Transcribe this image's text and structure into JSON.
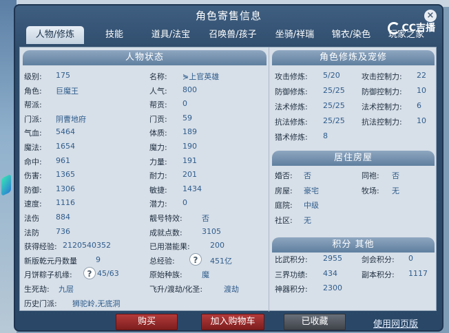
{
  "window": {
    "title": "角色寄售信息",
    "close_label": "×",
    "logo_text": "CC吉播"
  },
  "tabs": [
    "人物/修炼",
    "技能",
    "道具/法宝",
    "召唤兽/孩子",
    "坐骑/祥瑞",
    "锦衣/染色",
    "玩家之家"
  ],
  "left": {
    "header": "人物状态",
    "rows": [
      {
        "l1": "级别:",
        "v1": "175",
        "l2": "名称:",
        "v2": "⋟上官英雄"
      },
      {
        "l1": "角色:",
        "v1": "巨魔王",
        "l2": "人气:",
        "v2": "800"
      },
      {
        "l1": "帮派:",
        "v1": "",
        "l2": "帮贡:",
        "v2": "0"
      },
      {
        "l1": "门派:",
        "v1": "阴曹地府",
        "l2": "门贡:",
        "v2": "59"
      },
      {
        "l1": "气血:",
        "v1": "5464",
        "l2": "体质:",
        "v2": "189"
      },
      {
        "l1": "魔法:",
        "v1": "1654",
        "l2": "魔力:",
        "v2": "190"
      },
      {
        "l1": "命中:",
        "v1": "961",
        "l2": "力量:",
        "v2": "191"
      },
      {
        "l1": "伤害:",
        "v1": "1365",
        "l2": "耐力:",
        "v2": "201"
      },
      {
        "l1": "防御:",
        "v1": "1306",
        "l2": "敏捷:",
        "v2": "1434"
      },
      {
        "l1": "速度:",
        "v1": "1116",
        "l2": "潜力:",
        "v2": "0"
      },
      {
        "l1": "法伤",
        "v1": "884",
        "l2": "靓号特效:",
        "v2": "否"
      },
      {
        "l1": "法防",
        "v1": "736",
        "l2": "成就点数:",
        "v2": "3105"
      },
      {
        "l1": "获得经验:",
        "v1": "2120540352",
        "l2": "已用潜能果:",
        "v2": "200"
      },
      {
        "l1": "新版乾元丹数量",
        "v1": "9",
        "l2": "总经验:",
        "v2": "451亿"
      },
      {
        "l1": "月饼粽子机缘:",
        "v1": "45/63",
        "l2": "原始种族:",
        "v2": "魔"
      },
      {
        "l1": "生死劫:",
        "v1": "九层",
        "l2": "飞升/渡劫/化圣:",
        "v2": "渡劫"
      },
      {
        "l1": "历史门派:",
        "v1": "狮驼岭,无底洞",
        "l2": "",
        "v2": ""
      }
    ]
  },
  "cultivation": {
    "header": "角色修炼及宠修",
    "rows": [
      {
        "l1": "攻击修炼:",
        "v1": "5/20",
        "l2": "攻击控制力:",
        "v2": "22"
      },
      {
        "l1": "防御修炼:",
        "v1": "25/25",
        "l2": "防御控制力:",
        "v2": "10"
      },
      {
        "l1": "法术修炼:",
        "v1": "25/25",
        "l2": "法术控制力:",
        "v2": "6"
      },
      {
        "l1": "抗法修炼:",
        "v1": "25/25",
        "l2": "抗法控制力:",
        "v2": "10"
      },
      {
        "l1": "猎术修炼:",
        "v1": "8",
        "l2": "",
        "v2": ""
      }
    ]
  },
  "house": {
    "header": "居住房屋",
    "rows": [
      {
        "l1": "婚否:",
        "v1": "否",
        "l2": "同袍:",
        "v2": "否"
      },
      {
        "l1": "房屋:",
        "v1": "豪宅",
        "l2": "牧场:",
        "v2": "无"
      },
      {
        "l1": "庭院:",
        "v1": "中级",
        "l2": "",
        "v2": ""
      },
      {
        "l1": "社区:",
        "v1": "无",
        "l2": "",
        "v2": ""
      }
    ]
  },
  "points": {
    "header": "积分 其他",
    "rows": [
      {
        "l1": "比武积分:",
        "v1": "2955",
        "l2": "剑会积分:",
        "v2": "0"
      },
      {
        "l1": "三界功绩:",
        "v1": "434",
        "l2": "副本积分:",
        "v2": "1117"
      },
      {
        "l1": "神器积分:",
        "v1": "2300",
        "l2": "",
        "v2": ""
      }
    ]
  },
  "help_icon": "?",
  "buttons": {
    "buy": "购买",
    "add_cart": "加入购物车",
    "favorited": "已收藏",
    "web_link": "使用网页版"
  },
  "colors": {
    "label": "#1f2f40",
    "value": "#2e5c8c",
    "buy": "#9e2f2f",
    "favorited": "#50565e"
  }
}
